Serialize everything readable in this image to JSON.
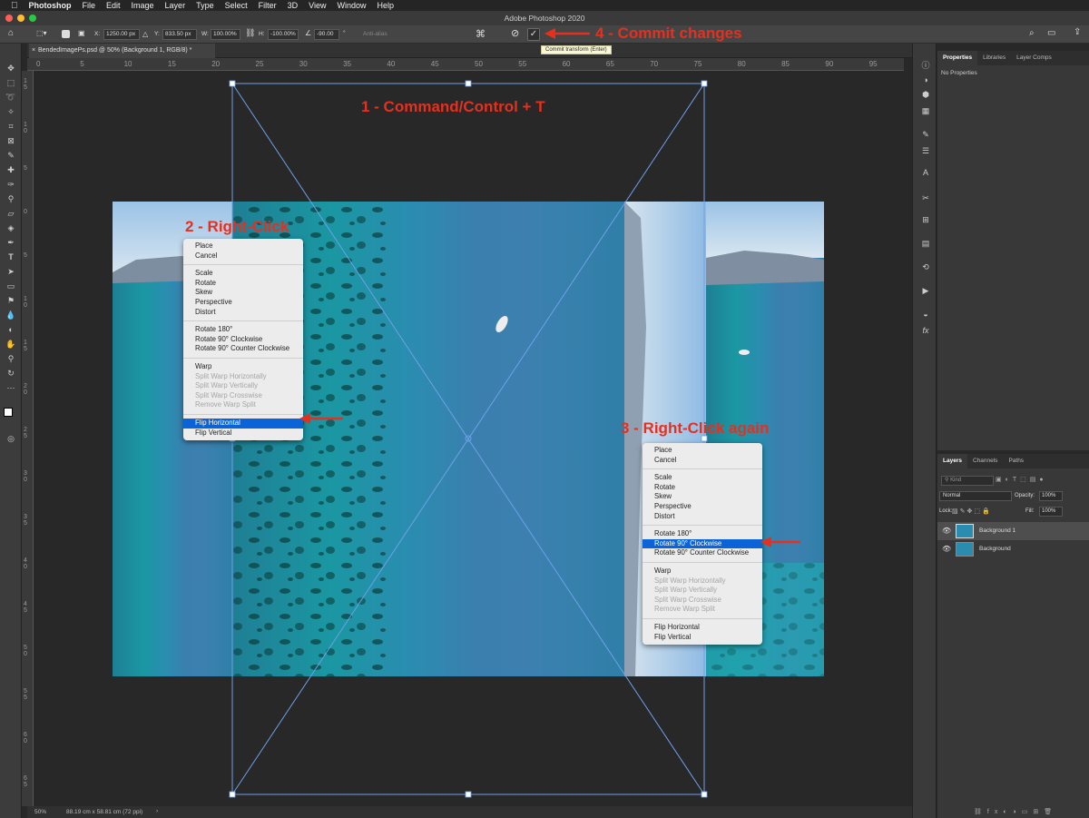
{
  "menubar": {
    "app": "Photoshop",
    "items": [
      "File",
      "Edit",
      "Image",
      "Layer",
      "Type",
      "Select",
      "Filter",
      "3D",
      "View",
      "Window",
      "Help"
    ]
  },
  "window_title": "Adobe Photoshop 2020",
  "options": {
    "x_label": "X:",
    "x_value": "1250.00 px",
    "y_label": "Y:",
    "y_value": "833.50 px",
    "w_label": "W:",
    "w_value": "100.00%",
    "h_label": "H:",
    "h_value": "-100.00%",
    "angle_value": "-90.00",
    "antialias": "Anti-alias",
    "commit_tooltip": "Commit transform (Enter)"
  },
  "document_tab": "BendedImagePs.psd @ 50% (Background 1, RGB/8) *",
  "ruler_h": [
    "0",
    "5",
    "10",
    "15",
    "20",
    "25",
    "30",
    "35",
    "40",
    "45",
    "50",
    "55",
    "60",
    "65",
    "70",
    "75",
    "80",
    "85",
    "90",
    "95",
    "10"
  ],
  "ruler_v": [
    "1 5",
    "1 0",
    "5",
    "0",
    "5",
    "1 0",
    "1 5",
    "2 0",
    "2 5",
    "3 0",
    "3 5",
    "4 0",
    "4 5",
    "5 0",
    "5 5",
    "6 0",
    "6 5",
    "7 0"
  ],
  "status": {
    "zoom": "50%",
    "doc_size": "88.19 cm x 58.81 cm (72 ppi)"
  },
  "properties": {
    "tabs": [
      "Properties",
      "Libraries",
      "Layer Comps"
    ],
    "empty_text": "No Properties"
  },
  "layers": {
    "tabs": [
      "Layers",
      "Channels",
      "Paths"
    ],
    "kind_placeholder": "Kind",
    "blend_mode": "Normal",
    "opacity_label": "Opacity:",
    "opacity_value": "100%",
    "lock_label": "Lock:",
    "fill_label": "Fill:",
    "fill_value": "100%",
    "rows": [
      {
        "name": "Background 1",
        "selected": true
      },
      {
        "name": "Background",
        "selected": false
      }
    ]
  },
  "annotations": {
    "a1": "1 - Command/Control + T",
    "a2": "2 - Right-Click",
    "a3": "3 - Right-Click again",
    "a4": "4 - Commit changes"
  },
  "menu1": {
    "items": [
      {
        "label": "Place"
      },
      {
        "label": "Cancel"
      },
      {
        "sep": true
      },
      {
        "label": "Scale"
      },
      {
        "label": "Rotate"
      },
      {
        "label": "Skew"
      },
      {
        "label": "Perspective"
      },
      {
        "label": "Distort"
      },
      {
        "sep": true
      },
      {
        "label": "Rotate 180°"
      },
      {
        "label": "Rotate 90° Clockwise"
      },
      {
        "label": "Rotate 90° Counter Clockwise"
      },
      {
        "sep": true
      },
      {
        "label": "Warp"
      },
      {
        "label": "Split Warp Horizontally",
        "disabled": true
      },
      {
        "label": "Split Warp Vertically",
        "disabled": true
      },
      {
        "label": "Split Warp Crosswise",
        "disabled": true
      },
      {
        "label": "Remove Warp Split",
        "disabled": true
      },
      {
        "sep": true
      },
      {
        "label": "Flip Horizontal",
        "selected": true
      },
      {
        "label": "Flip Vertical"
      }
    ]
  },
  "menu2": {
    "items": [
      {
        "label": "Place"
      },
      {
        "label": "Cancel"
      },
      {
        "sep": true
      },
      {
        "label": "Scale"
      },
      {
        "label": "Rotate"
      },
      {
        "label": "Skew"
      },
      {
        "label": "Perspective"
      },
      {
        "label": "Distort"
      },
      {
        "sep": true
      },
      {
        "label": "Rotate 180°"
      },
      {
        "label": "Rotate 90° Clockwise",
        "selected": true
      },
      {
        "label": "Rotate 90° Counter Clockwise"
      },
      {
        "sep": true
      },
      {
        "label": "Warp"
      },
      {
        "label": "Split Warp Horizontally",
        "disabled": true
      },
      {
        "label": "Split Warp Vertically",
        "disabled": true
      },
      {
        "label": "Split Warp Crosswise",
        "disabled": true
      },
      {
        "label": "Remove Warp Split",
        "disabled": true
      },
      {
        "sep": true
      },
      {
        "label": "Flip Horizontal"
      },
      {
        "label": "Flip Vertical"
      }
    ]
  },
  "colors": {
    "accent": "#0a64d8",
    "annotation": "#e6301f",
    "transform_box": "#6fa0e8"
  }
}
